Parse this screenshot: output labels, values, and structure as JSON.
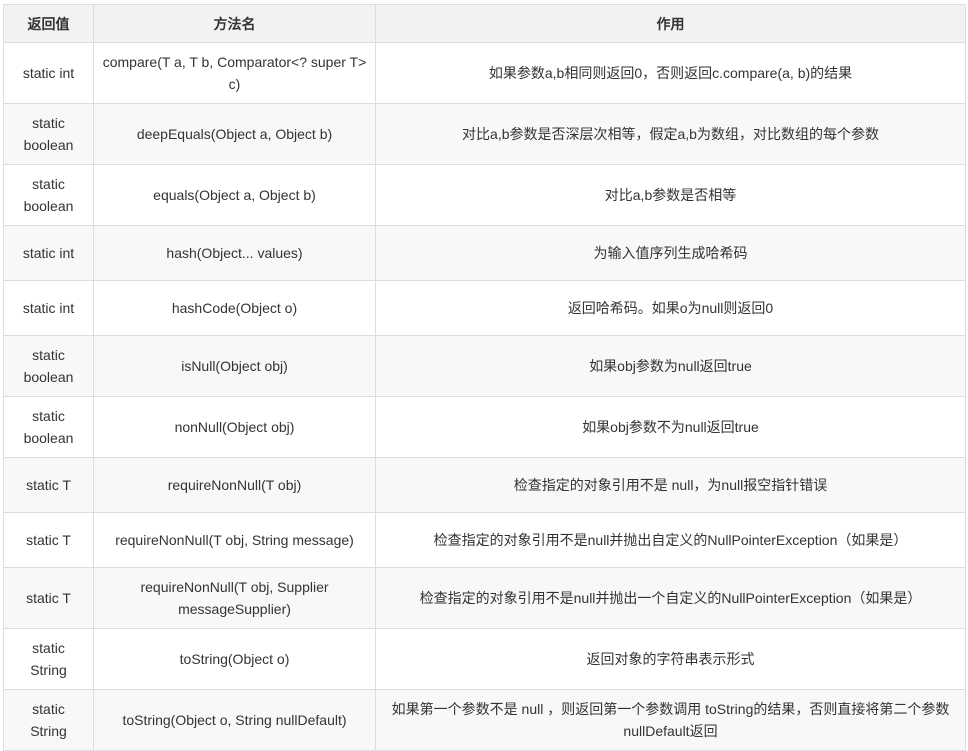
{
  "table": {
    "headers": [
      "返回值",
      "方法名",
      "作用"
    ],
    "rows": [
      {
        "ret": "static int",
        "method": "compare(T a, T b, Comparator<? super T> c)",
        "desc": "如果参数a,b相同则返回0，否则返回c.compare(a, b)的结果"
      },
      {
        "ret": "static boolean",
        "method": "deepEquals(Object a, Object b)",
        "desc": "对比a,b参数是否深层次相等，假定a,b为数组，对比数组的每个参数"
      },
      {
        "ret": "static boolean",
        "method": "equals(Object a, Object b)",
        "desc": "对比a,b参数是否相等"
      },
      {
        "ret": "static int",
        "method": "hash(Object... values)",
        "desc": "为输入值序列生成哈希码"
      },
      {
        "ret": "static int",
        "method": "hashCode(Object o)",
        "desc": "返回哈希码。如果o为null则返回0"
      },
      {
        "ret": "static boolean",
        "method": "isNull(Object obj)",
        "desc": "如果obj参数为null返回true"
      },
      {
        "ret": "static boolean",
        "method": "nonNull(Object obj)",
        "desc": "如果obj参数不为null返回true"
      },
      {
        "ret": "static T",
        "method": "requireNonNull(T obj)",
        "desc": "检查指定的对象引用不是 null，为null报空指针错误"
      },
      {
        "ret": "static T",
        "method": "requireNonNull(T obj, String message)",
        "desc": "检查指定的对象引用不是null并抛出自定义的NullPointerException（如果是）"
      },
      {
        "ret": "static T",
        "method": "requireNonNull(T obj, Supplier messageSupplier)",
        "desc": "检查指定的对象引用不是null并抛出一个自定义的NullPointerException（如果是）"
      },
      {
        "ret": "static String",
        "method": "toString(Object o)",
        "desc": "返回对象的字符串表示形式"
      },
      {
        "ret": "static String",
        "method": "toString(Object o, String nullDefault)",
        "desc": "如果第一个参数不是 null ，则返回第一个参数调用 toString的结果，否则直接将第二个参数nullDefault返回"
      }
    ]
  }
}
